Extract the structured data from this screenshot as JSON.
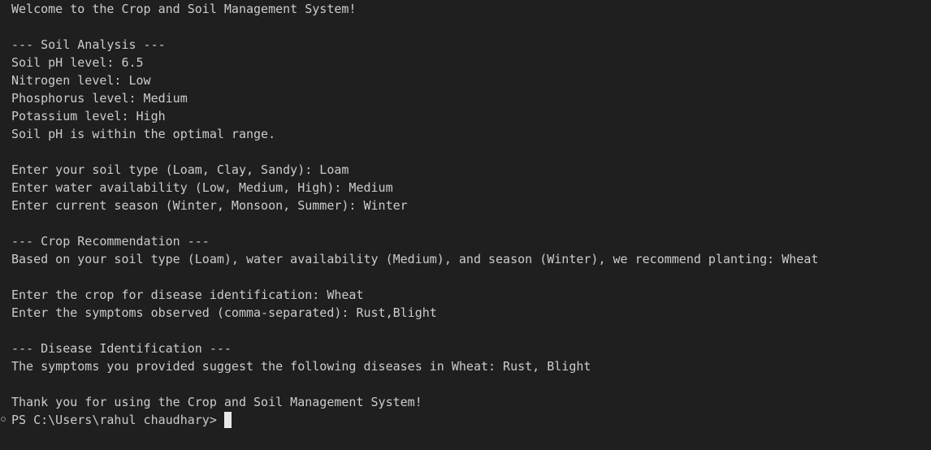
{
  "terminal": {
    "lines": [
      "Welcome to the Crop and Soil Management System!",
      "",
      "--- Soil Analysis ---",
      "Soil pH level: 6.5",
      "Nitrogen level: Low",
      "Phosphorus level: Medium",
      "Potassium level: High",
      "Soil pH is within the optimal range.",
      "",
      "Enter your soil type (Loam, Clay, Sandy): Loam",
      "Enter water availability (Low, Medium, High): Medium",
      "Enter current season (Winter, Monsoon, Summer): Winter",
      "",
      "--- Crop Recommendation ---",
      "Based on your soil type (Loam), water availability (Medium), and season (Winter), we recommend planting: Wheat",
      "",
      "Enter the crop for disease identification: Wheat",
      "Enter the symptoms observed (comma-separated): Rust,Blight",
      "",
      "--- Disease Identification ---",
      "The symptoms you provided suggest the following diseases in Wheat: Rust, Blight",
      "",
      "Thank you for using the Crop and Soil Management System!"
    ],
    "prompt": "PS C:\\Users\\rahul chaudhary> ",
    "colors": {
      "background": "#1f1f1f",
      "text": "#cccccc",
      "cursor": "#e8e8e8"
    }
  }
}
